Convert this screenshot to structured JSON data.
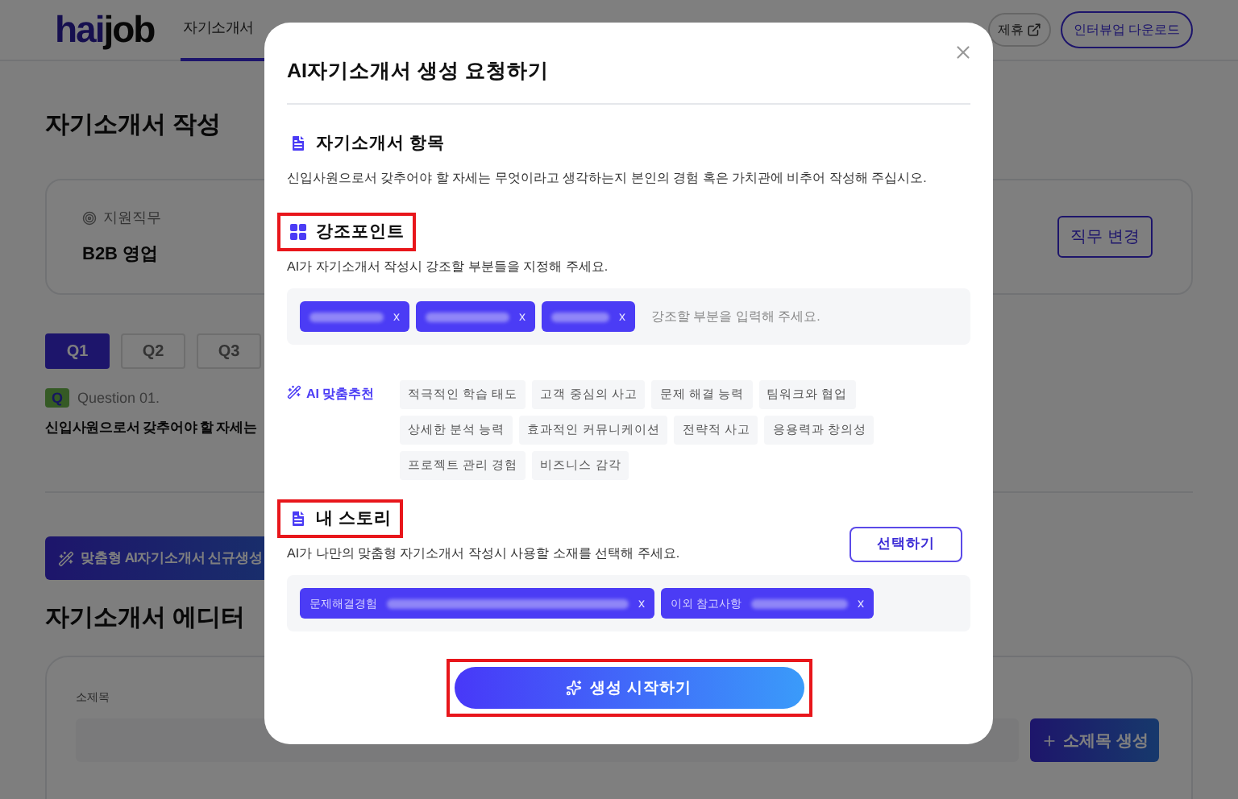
{
  "header": {
    "logo_primary": "hai",
    "logo_secondary": "job",
    "nav": [
      {
        "label": "자기소개서",
        "selected": true
      }
    ],
    "partner_link": "제휴",
    "download_button": "인터뷰업 다운로드"
  },
  "page": {
    "title": "자기소개서 작성",
    "job_label": "지원직무",
    "job_value": "B2B 영업",
    "change_job_button": "직무 변경",
    "question_tabs": [
      {
        "label": "Q1",
        "selected": true
      },
      {
        "label": "Q2",
        "selected": false
      },
      {
        "label": "Q3",
        "selected": false
      }
    ],
    "question_badge": "Q",
    "question_number": "Question 01.",
    "question_text": "신입사원으로서 갖추어야 할 자세는",
    "ai_button": "맞춤형 AI자기소개서 신규생성",
    "editor_title": "자기소개서 에디터",
    "subtitle_label": "소제목",
    "add_subtitle_button": "소제목 생성"
  },
  "modal": {
    "title": "AI자기소개서 생성 요청하기",
    "item_section": {
      "title": "자기소개서 항목",
      "description": "신입사원으로서 갖추어야 할 자세는 무엇이라고 생각하는지 본인의 경험 혹은 가치관에 비추어 작성해 주십시오."
    },
    "emphasis_section": {
      "title": "강조포인트",
      "highlighted": true,
      "description": "AI가 자기소개서 작성시 강조할 부분들을 지정해 주세요.",
      "chips": [
        {
          "remove": "x"
        },
        {
          "remove": "x"
        },
        {
          "remove": "x"
        }
      ],
      "placeholder": "강조할 부분을 입력해 주세요."
    },
    "recommend_label": "AI 맞춤추천",
    "recommendations": [
      "적극적인 학습 태도",
      "고객 중심의 사고",
      "문제 해결 능력",
      "팀워크와 협업",
      "상세한 분석 능력",
      "효과적인 커뮤니케이션",
      "전략적 사고",
      "응용력과 창의성",
      "프로젝트 관리 경험",
      "비즈니스 감각"
    ],
    "story_section": {
      "title": "내 스토리",
      "highlighted": true,
      "description": "AI가 나만의 맞춤형 자기소개서 작성시 사용할 소재를 선택해 주세요.",
      "select_button": "선택하기",
      "chips": [
        {
          "label": "문제해결경험",
          "remove": "x"
        },
        {
          "label": "이외 참고사항",
          "remove": "x"
        }
      ]
    },
    "start_button": {
      "label": "생성 시작하기",
      "highlighted": true
    }
  }
}
